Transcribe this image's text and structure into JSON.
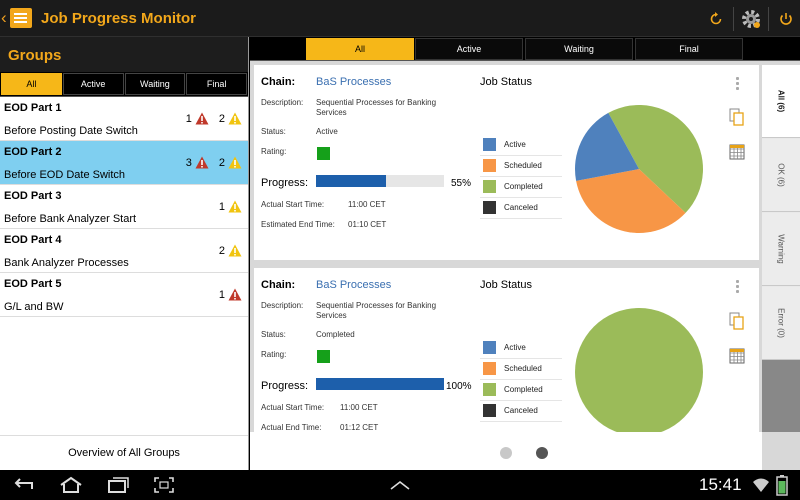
{
  "app": {
    "title": "Job Progress Monitor"
  },
  "colors": {
    "accent": "#f2a71b",
    "active": "#4f81bd",
    "scheduled": "#f79646",
    "completed": "#9bbb59",
    "canceled": "#333333",
    "warning_red": "#c0392b",
    "warning_yellow": "#f1c40f",
    "selection": "#7fcff0"
  },
  "groups_panel": {
    "title": "Groups",
    "filters": [
      "All",
      "Active",
      "Waiting",
      "Final"
    ],
    "active_filter": 0,
    "items": [
      {
        "name": "EOD Part 1",
        "subtitle": "Before Posting Date Switch",
        "red_count": "1",
        "yellow_count": "2"
      },
      {
        "name": "EOD Part 2",
        "subtitle": "Before EOD Date Switch",
        "red_count": "3",
        "yellow_count": "2"
      },
      {
        "name": "EOD Part 3",
        "subtitle": "Before Bank Analyzer Start",
        "red_count": "",
        "yellow_count": "1"
      },
      {
        "name": "EOD Part 4",
        "subtitle": "Bank Analyzer Processes",
        "red_count": "",
        "yellow_count": "2"
      },
      {
        "name": "EOD Part 5",
        "subtitle": "G/L and BW",
        "red_count": "1",
        "yellow_count": ""
      }
    ],
    "footer": "Overview of All Groups"
  },
  "main_tabs": [
    "All",
    "Active",
    "Waiting",
    "Final"
  ],
  "side_tabs": [
    "All (6)",
    "OK (6)",
    "Warning",
    "Error (0)"
  ],
  "labels": {
    "chain": "Chain:",
    "description": "Description:",
    "status": "Status:",
    "rating": "Rating:",
    "progress": "Progress:",
    "actual_start": "Actual Start Time:",
    "estimated_end": "Estimated End Time:",
    "actual_end": "Actual End Time:",
    "job_status": "Job Status"
  },
  "legend": [
    "Active",
    "Scheduled",
    "Completed",
    "Canceled"
  ],
  "cards": [
    {
      "chain": "BaS Processes",
      "description": "Sequential Processes for Banking Services",
      "status": "Active",
      "progress": 55,
      "progress_text": "55%",
      "start_time": "11:00 CET",
      "end_time": "01:10 CET",
      "slices": {
        "active": 20,
        "scheduled": 35,
        "completed": 45,
        "canceled": 0
      }
    },
    {
      "chain": "BaS Processes",
      "description": "Sequential Processes for Banking Services",
      "status": "Completed",
      "progress": 100,
      "progress_text": "100%",
      "start_time": "11:00 CET",
      "end_time": "01:12 CET",
      "slices": {
        "active": 0,
        "scheduled": 0,
        "completed": 100,
        "canceled": 0
      }
    }
  ],
  "pager": {
    "pages": 2,
    "current": 1
  },
  "system": {
    "time": "15:41"
  }
}
